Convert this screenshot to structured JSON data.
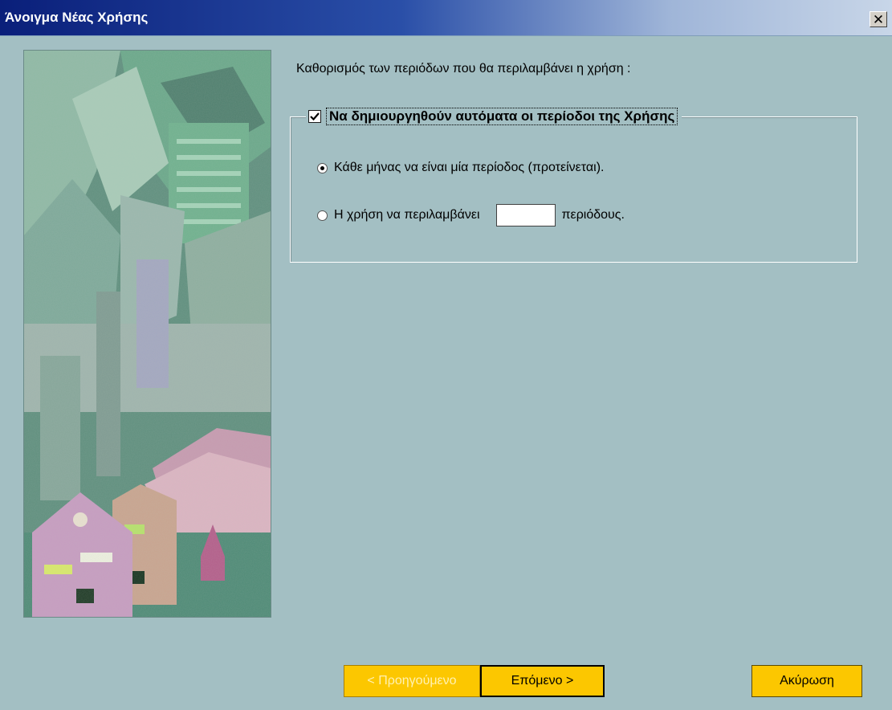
{
  "window": {
    "title": "Άνοιγμα Νέας Χρήσης",
    "close_symbol": "✕"
  },
  "description": "Καθορισμός των περιόδων που θα περιλαμβάνει η χρήση :",
  "auto_periods": {
    "label": "Να δημιουργηθούν αυτόματα οι περίοδοι της Χρήσης",
    "checked": true,
    "icon": "check-icon"
  },
  "options": {
    "monthly": {
      "label": "Κάθε μήνας να είναι μία περίοδος (προτείνεται).",
      "selected": true
    },
    "custom": {
      "prefix": "Η χρήση να περιλαμβάνει",
      "value": "",
      "suffix": "περιόδους.",
      "selected": false
    }
  },
  "buttons": {
    "back": "< Προηγούμενο",
    "next": "Επόμενο >",
    "cancel": "Ακύρωση"
  },
  "colors": {
    "background": "#a3bfc3",
    "button": "#fcc700",
    "title_bar": "#0a1f7a"
  }
}
